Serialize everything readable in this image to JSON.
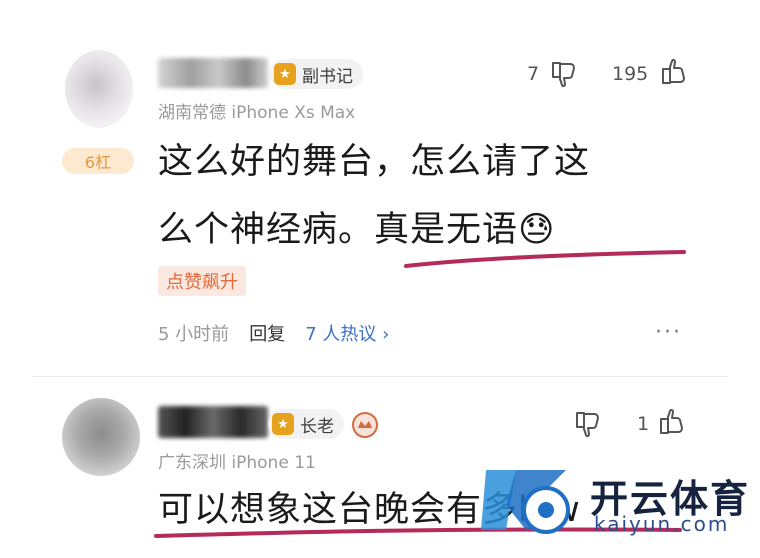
{
  "comments": [
    {
      "badge": "副书记",
      "location_device": "湖南常德  iPhone Xs Max",
      "dislike_count": "7",
      "like_count": "195",
      "level": "6杠",
      "text_line1": "这么好的舞台，怎么请了这",
      "text_line2": "么个神经病。真是无语",
      "emoji": "😓",
      "tag": "点赞飙升",
      "time": "5 小时前",
      "reply": "回复",
      "hot_discussion": "7 人热议 ›",
      "more": "···"
    },
    {
      "badge": "长老",
      "location_device": "广东深圳  iPhone 11",
      "like_count": "1",
      "text_line1": "可以想象这台晚会有多low"
    }
  ],
  "watermark": {
    "brand": "开云体育",
    "site": "kaiyun.com"
  },
  "colors": {
    "accent_underline": "#b42a5a",
    "badge_gold": "#e7a21d",
    "link_blue": "#3d6ec9",
    "tag_orange": "#e26b3b"
  }
}
